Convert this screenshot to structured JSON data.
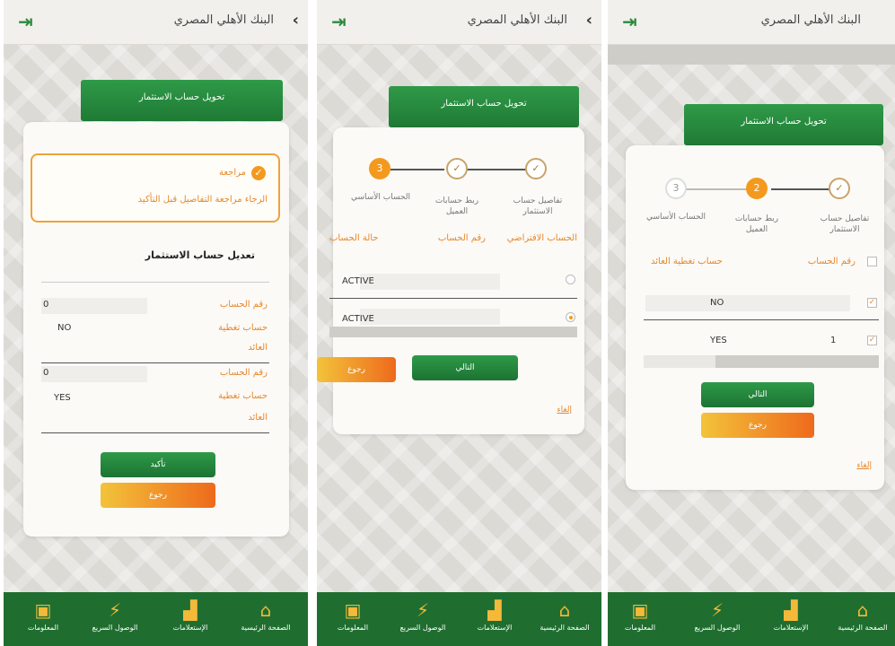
{
  "app": {
    "title": "البنك الأهلي المصري",
    "back_icon": "chevron-left-icon",
    "exit_icon": "logout-icon",
    "tab_header": "تحويل حساب الاستثمار"
  },
  "nav": [
    {
      "label": "المعلومات",
      "icon": "info-box-icon"
    },
    {
      "label": "الوصول السريع",
      "icon": "lightning-icon"
    },
    {
      "label": "الإستعلامات",
      "icon": "chart-bars-icon"
    },
    {
      "label": "الصفحة الرئيسية",
      "icon": "home-icon"
    }
  ],
  "screen1": {
    "review_title": "مراجعة",
    "review_text": "الرجاء مراجعة التفاصيل قبل التأكيد",
    "section_title": "تعديل حساب الاستثمار",
    "rows": [
      {
        "account_label": "رقم الحساب",
        "account_value": "0",
        "coverage_label_1": "حساب تغطية",
        "coverage_label_2": "العائد",
        "coverage_value": "NO"
      },
      {
        "account_label": "رقم الحساب",
        "account_value": "0",
        "coverage_label_1": "حساب تغطية",
        "coverage_label_2": "العائد",
        "coverage_value": "YES"
      }
    ],
    "confirm_label": "تأكيد",
    "back_label": "رجوع"
  },
  "screen2": {
    "steps": [
      {
        "label": "تفاصيل حساب الاستثمار",
        "state": "done"
      },
      {
        "label": "ربط حسابات العميل",
        "state": "done"
      },
      {
        "label": "الحساب الأساسي",
        "state": "current",
        "number": "3"
      }
    ],
    "columns": [
      "الحساب الافتراضي",
      "رقم الحساب",
      "حالة الحساب"
    ],
    "rows": [
      {
        "status": "ACTIVE",
        "selected": false
      },
      {
        "status": "ACTIVE",
        "selected": true
      }
    ],
    "next_label": "التالي",
    "back_label": "رجوع",
    "cancel_label": "إلغاء"
  },
  "screen3": {
    "steps": [
      {
        "label": "تفاصيل حساب الاستثمار",
        "state": "done"
      },
      {
        "label": "ربط حسابات العميل",
        "state": "current",
        "number": "2"
      },
      {
        "label": "الحساب الأساسي",
        "state": "todo",
        "number": "3"
      }
    ],
    "columns": [
      "رقم الحساب",
      "حساب تغطية العائد"
    ],
    "rows": [
      {
        "coverage": "NO",
        "account": "",
        "checked": true
      },
      {
        "coverage": "YES",
        "account": "1",
        "checked": true
      }
    ],
    "next_label": "التالي",
    "back_label": "رجوع",
    "cancel_label": "إلغاء"
  },
  "colors": {
    "brand_green": "#1f7a35",
    "accent_orange": "#f39a1e"
  }
}
